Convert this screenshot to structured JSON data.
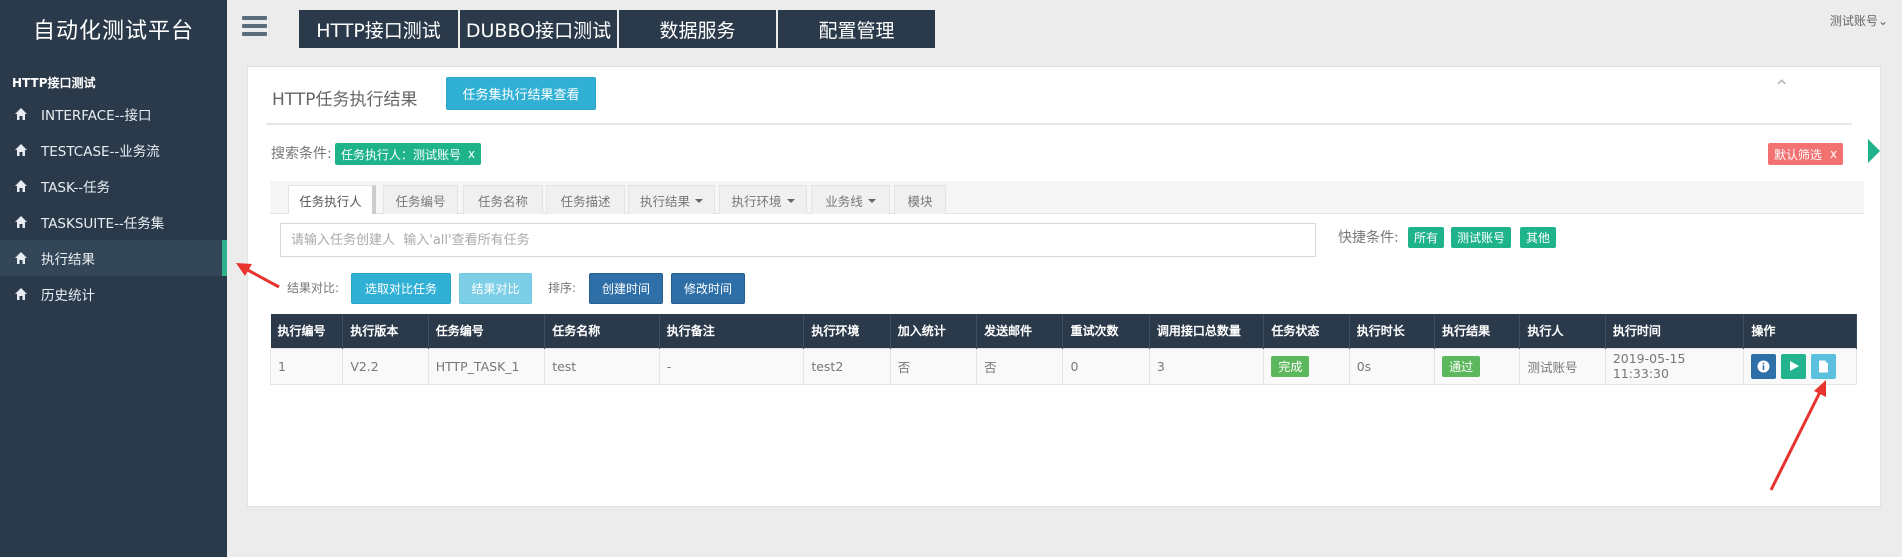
{
  "brand": "自动化测试平台",
  "sidebar": {
    "section": "HTTP接口测试",
    "items": [
      {
        "label": "INTERFACE--接口",
        "icon": "home-icon"
      },
      {
        "label": "TESTCASE--业务流",
        "icon": "home-icon"
      },
      {
        "label": "TASK--任务",
        "icon": "home-icon"
      },
      {
        "label": "TASKSUITE--任务集",
        "icon": "home-icon"
      },
      {
        "label": "执行结果",
        "icon": "home-icon",
        "active": true
      },
      {
        "label": "历史统计",
        "icon": "home-icon"
      }
    ]
  },
  "topnav": [
    "HTTP接口测试",
    "DUBBO接口测试",
    "数据服务",
    "配置管理"
  ],
  "account": "测试账号",
  "panel": {
    "title": "HTTP任务执行结果",
    "suite_button": "任务集执行结果查看",
    "collapse_icon": "chevron-up-icon"
  },
  "search": {
    "label": "搜索条件:",
    "condition_tag": "任务执行人：测试账号",
    "tag_close": "x",
    "default_filter": "默认筛选",
    "placeholder": "请输入任务创建人  输入'all'查看所有任务",
    "quick_label": "快捷条件:",
    "quick_tags": [
      "所有",
      "测试账号",
      "其他"
    ]
  },
  "tabs": [
    {
      "label": "任务执行人",
      "dropdown": false
    },
    {
      "label": "任务编号",
      "dropdown": false
    },
    {
      "label": "任务名称",
      "dropdown": false
    },
    {
      "label": "任务描述",
      "dropdown": false
    },
    {
      "label": "执行结果",
      "dropdown": true
    },
    {
      "label": "执行环境",
      "dropdown": true
    },
    {
      "label": "业务线",
      "dropdown": true
    },
    {
      "label": "模块",
      "dropdown": false
    }
  ],
  "compare": {
    "label": "结果对比:",
    "select_button": "选取对比任务",
    "compare_button": "结果对比",
    "sort_label": "排序:",
    "sort_created": "创建时间",
    "sort_modified": "修改时间"
  },
  "table": {
    "headers": [
      "执行编号",
      "执行版本",
      "任务编号",
      "任务名称",
      "执行备注",
      "执行环境",
      "加入统计",
      "发送邮件",
      "重试次数",
      "调用接口总数量",
      "任务状态",
      "执行时长",
      "执行结果",
      "执行人",
      "执行时间",
      "操作"
    ],
    "rows": [
      [
        "1",
        "V2.2",
        "HTTP_TASK_1",
        "test",
        "-",
        "test2",
        "否",
        "否",
        "0",
        "3",
        "完成",
        "0s",
        "通过",
        "测试账号",
        "2019-05-15 11:33:30",
        ""
      ]
    ]
  },
  "colors": {
    "sidebar": "#2b3a4a",
    "accent_green": "#1fb38c",
    "info": "#31b0d5",
    "primary": "#2f6fa8",
    "danger": "#f27272",
    "arrow": "#e8332f"
  }
}
